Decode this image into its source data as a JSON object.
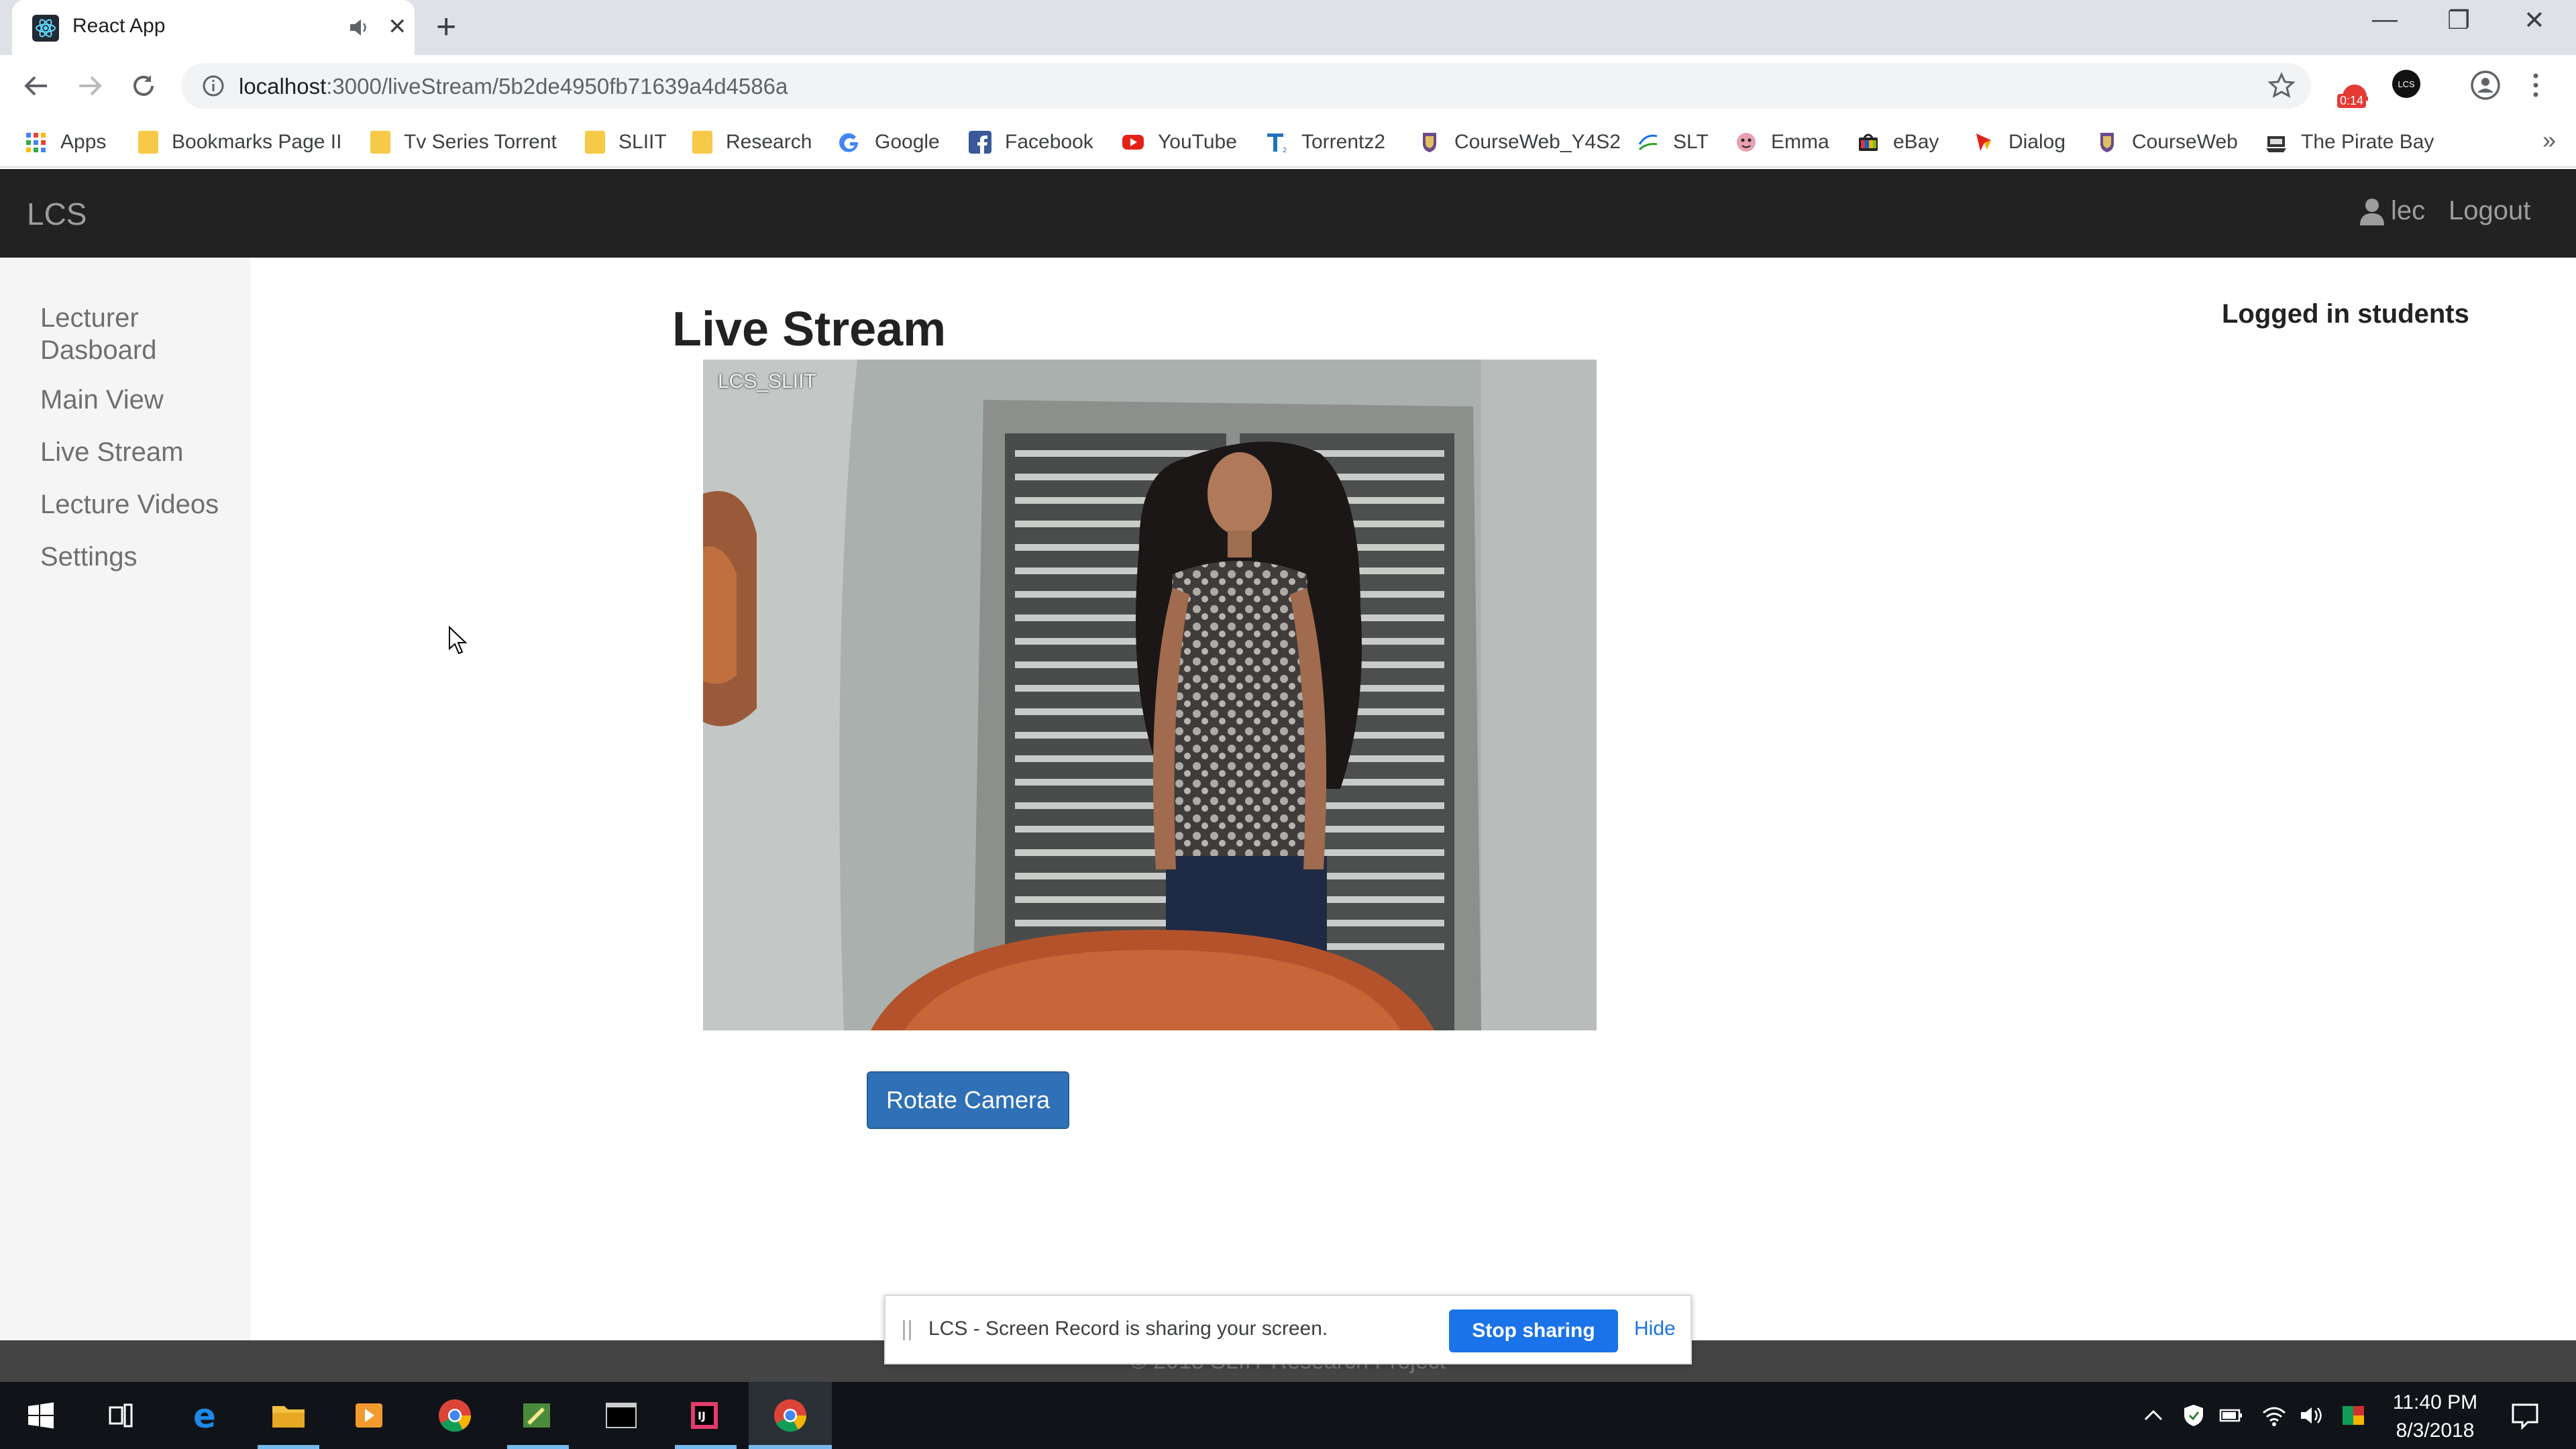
{
  "browser": {
    "tab": {
      "title": "React App"
    },
    "url": {
      "host": "localhost",
      "path": ":3000/liveStream/5b2de4950fb71639a4d4586a"
    },
    "extension_badge": "0:14",
    "extension_lcs": "LCS",
    "bookmarks": [
      {
        "label": "Apps",
        "icon": "apps-grid-icon"
      },
      {
        "label": "Bookmarks Page II",
        "icon": "folder-icon"
      },
      {
        "label": "Tv Series Torrent",
        "icon": "folder-icon"
      },
      {
        "label": "SLIIT",
        "icon": "folder-icon"
      },
      {
        "label": "Research",
        "icon": "folder-icon"
      },
      {
        "label": "Google",
        "icon": "google-icon"
      },
      {
        "label": "Facebook",
        "icon": "facebook-icon"
      },
      {
        "label": "YouTube",
        "icon": "youtube-icon"
      },
      {
        "label": "Torrentz2",
        "icon": "torrentz-icon"
      },
      {
        "label": "CourseWeb_Y4S2",
        "icon": "courseweb-icon"
      },
      {
        "label": "SLT",
        "icon": "slt-icon"
      },
      {
        "label": "Emma",
        "icon": "emma-icon"
      },
      {
        "label": "eBay",
        "icon": "ebay-icon"
      },
      {
        "label": "Dialog",
        "icon": "dialog-icon"
      },
      {
        "label": "CourseWeb",
        "icon": "courseweb-icon"
      },
      {
        "label": "The Pirate Bay",
        "icon": "piratebay-icon"
      }
    ],
    "bookmarks_more": "»"
  },
  "app": {
    "brand": "LCS",
    "user": "lec",
    "logout": "Logout",
    "sidebar": [
      {
        "label": "Lecturer Dasboard"
      },
      {
        "label": "Main View"
      },
      {
        "label": "Live Stream"
      },
      {
        "label": "Lecture Videos"
      },
      {
        "label": "Settings"
      }
    ],
    "page_title": "Live Stream",
    "students_title": "Logged in students",
    "video_label": "LCS_SLIIT",
    "rotate_button": "Rotate Camera",
    "footer": "© 2018 SLIIT Research Project"
  },
  "share_bar": {
    "message": "LCS - Screen Record is sharing your screen.",
    "stop": "Stop sharing",
    "hide": "Hide"
  },
  "taskbar": {
    "time": "11:40 PM",
    "date": "8/3/2018"
  },
  "colors": {
    "navbar": "#222222",
    "sidebar": "#f5f5f5",
    "button_primary": "#2f70b6",
    "share_button": "#1a73e8",
    "taskbar": "#101318"
  }
}
